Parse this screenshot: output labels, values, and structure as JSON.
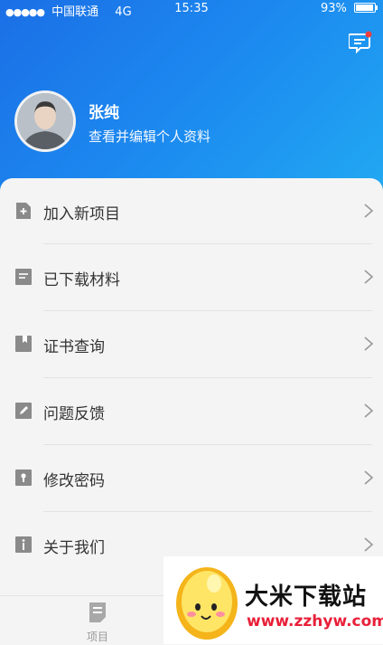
{
  "status_bar": {
    "signal_dots": "●●●●●",
    "carrier": "中国联通",
    "network": "4G",
    "time": "15:35",
    "battery": "93%",
    "battery_level": 0.93
  },
  "profile": {
    "name": "张纯",
    "subtitle": "查看并编辑个人资料",
    "avatar_icon": "person-avatar"
  },
  "header_icon": "message-notification-icon",
  "menu": [
    {
      "label": "加入新项目",
      "icon": "add-file-icon"
    },
    {
      "label": "已下载材料",
      "icon": "document-icon"
    },
    {
      "label": "证书查询",
      "icon": "certificate-bookmark-icon"
    },
    {
      "label": "问题反馈",
      "icon": "edit-feedback-icon"
    },
    {
      "label": "修改密码",
      "icon": "lock-icon"
    },
    {
      "label": "关于我们",
      "icon": "info-icon"
    }
  ],
  "tabbar": {
    "tabs": [
      {
        "label": "项目",
        "icon": "project-doc-icon"
      }
    ]
  },
  "ad": {
    "title": "大米下载站",
    "url": "www.zzhyw.com"
  },
  "colors": {
    "header_start": "#1b6fe6",
    "header_end": "#22a9f2",
    "icon_gray": "#8a8a8a",
    "ad_url": "#e8203a"
  }
}
